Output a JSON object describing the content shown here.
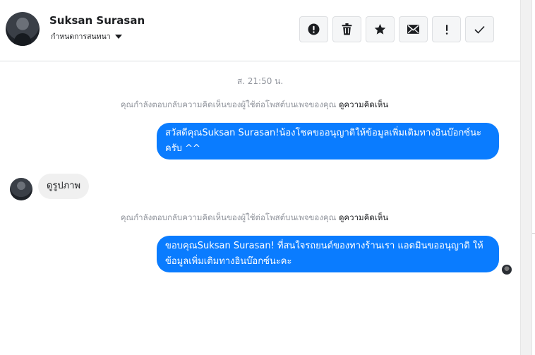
{
  "header": {
    "name": "Suksan Surasan",
    "subtitle": "กำหนดการสนทนา",
    "actions": [
      {
        "name": "alert-icon"
      },
      {
        "name": "trash-icon"
      },
      {
        "name": "star-icon"
      },
      {
        "name": "mail-icon"
      },
      {
        "name": "exclamation-icon"
      },
      {
        "name": "check-icon"
      }
    ]
  },
  "conversation": {
    "timestamp": "ส. 21:50 น.",
    "notice1": {
      "text": "คุณกำลังตอบกลับความคิดเห็นของผู้ใช้ต่อโพสต์บนเพจของคุณ",
      "link": "ดูความคิดเห็น"
    },
    "message1": "สวัสดีคุณSuksan Surasan!น้องโชคขออนุญาติให้ข้อมูลเพิ่มเติมทางอินบ๊อกซ์นะครับ ^^",
    "incoming": "ดูรูปภาพ",
    "notice2": {
      "text": "คุณกำลังตอบกลับความคิดเห็นของผู้ใช้ต่อโพสต์บนเพจของคุณ",
      "link": "ดูความคิดเห็น"
    },
    "message2": "ขอบคุณSuksan Surasan! ที่สนใจรถยนต์ของทางร้านเรา แอดมินขออนุญาติ ให้ข้อมูลเพิ่มเติมทางอินบ๊อกซ์นะคะ"
  }
}
